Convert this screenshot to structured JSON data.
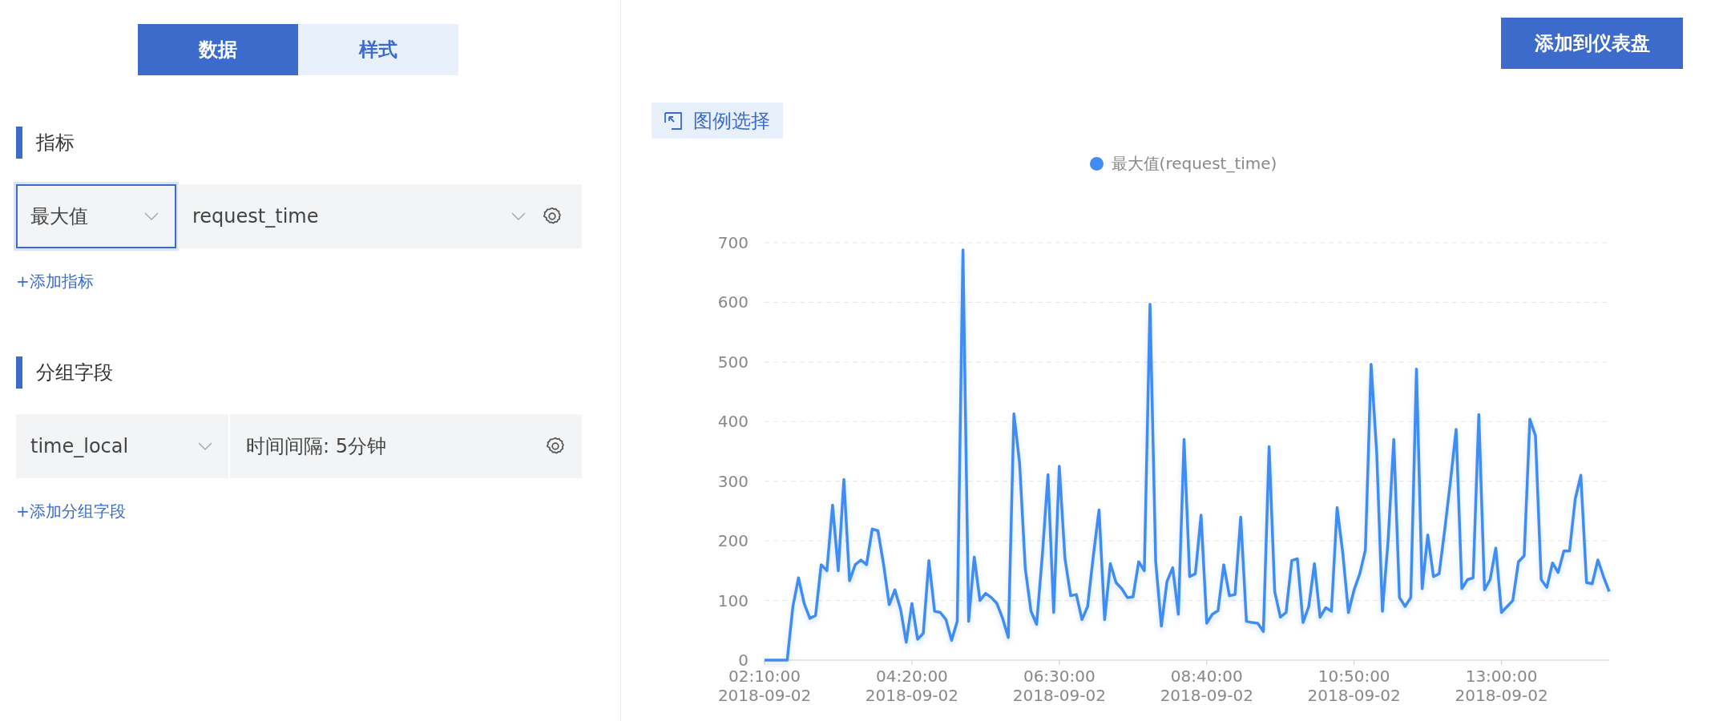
{
  "tabs": [
    {
      "label": "数据",
      "selected": true
    },
    {
      "label": "样式",
      "selected": false
    }
  ],
  "sections": [
    {
      "title": "指标",
      "row": [
        {
          "kind": "select",
          "value": "最大值",
          "focused": true
        },
        {
          "kind": "select",
          "value": "request_time",
          "focused": false
        },
        {
          "kind": "gear"
        }
      ],
      "add_link": "+添加指标"
    },
    {
      "title": "分组字段",
      "row": [
        {
          "kind": "select",
          "value": "time_local",
          "focused": false
        },
        {
          "kind": "text",
          "value": "时间间隔: 5分钟"
        },
        {
          "kind": "gear"
        }
      ],
      "add_link": "+添加分组字段"
    }
  ],
  "add_to_dashboard_button": "添加到仪表盘",
  "legend_select_button": "图例选择",
  "chart_data": {
    "type": "line",
    "series": [
      {
        "name": "最大值(request_time)",
        "color": "#3f8cf2",
        "values": [
          0,
          0,
          0,
          0,
          0,
          90,
          138,
          95,
          70,
          75,
          160,
          150,
          260,
          150,
          303,
          133,
          160,
          168,
          160,
          220,
          217,
          160,
          93,
          118,
          85,
          30,
          95,
          35,
          45,
          167,
          82,
          80,
          68,
          33,
          65,
          688,
          65,
          173,
          100,
          112,
          105,
          95,
          70,
          38,
          413,
          330,
          153,
          82,
          60,
          175,
          311,
          80,
          325,
          170,
          108,
          110,
          68,
          90,
          175,
          252,
          68,
          162,
          130,
          120,
          105,
          106,
          165,
          150,
          597,
          165,
          57,
          132,
          155,
          77,
          370,
          140,
          145,
          243,
          62,
          77,
          83,
          160,
          108,
          110,
          240,
          65,
          63,
          62,
          48,
          358,
          115,
          72,
          80,
          167,
          170,
          63,
          90,
          162,
          72,
          88,
          82,
          256,
          180,
          80,
          118,
          145,
          185,
          496,
          345,
          82,
          200,
          370,
          105,
          90,
          105,
          488,
          120,
          210,
          140,
          145,
          220,
          300,
          387,
          120,
          135,
          138,
          412,
          118,
          135,
          188,
          80,
          90,
          100,
          165,
          175,
          404,
          376,
          135,
          122,
          163,
          147,
          183,
          183,
          270,
          310,
          130,
          128,
          168,
          140,
          115
        ]
      }
    ],
    "categories": [
      "02:10:00 2018-09-02",
      null,
      null,
      null,
      null,
      null,
      null,
      null,
      null,
      null,
      null,
      null,
      null,
      null,
      null,
      null,
      null,
      null,
      null,
      null,
      null,
      null,
      null,
      null,
      null,
      null,
      "04:20:00 2018-09-02",
      null,
      null,
      null,
      null,
      null,
      null,
      null,
      null,
      null,
      null,
      null,
      null,
      null,
      null,
      null,
      null,
      null,
      null,
      null,
      null,
      null,
      null,
      null,
      null,
      null,
      "06:30:00 2018-09-02",
      null,
      null,
      null,
      null,
      null,
      null,
      null,
      null,
      null,
      null,
      null,
      null,
      null,
      null,
      null,
      null,
      null,
      null,
      null,
      null,
      null,
      null,
      null,
      null,
      null,
      "08:40:00 2018-09-02",
      null,
      null,
      null,
      null,
      null,
      null,
      null,
      null,
      null,
      null,
      null,
      null,
      null,
      null,
      null,
      null,
      null,
      null,
      null,
      null,
      null,
      null,
      null,
      null,
      null,
      "10:50:00 2018-09-02",
      null,
      null,
      null,
      null,
      null,
      null,
      null,
      null,
      null,
      null,
      null,
      null,
      null,
      null,
      null,
      null,
      null,
      null,
      null,
      null,
      null,
      null,
      null,
      null,
      null,
      "13:00:00 2018-09-02",
      null,
      null,
      null,
      null,
      null,
      null,
      null,
      null,
      null,
      null,
      null,
      null,
      null,
      null,
      null,
      null,
      null,
      null,
      null
    ],
    "ylim": [
      0,
      700
    ],
    "yticks": [
      0,
      100,
      200,
      300,
      400,
      500,
      600,
      700
    ],
    "grid": true
  }
}
